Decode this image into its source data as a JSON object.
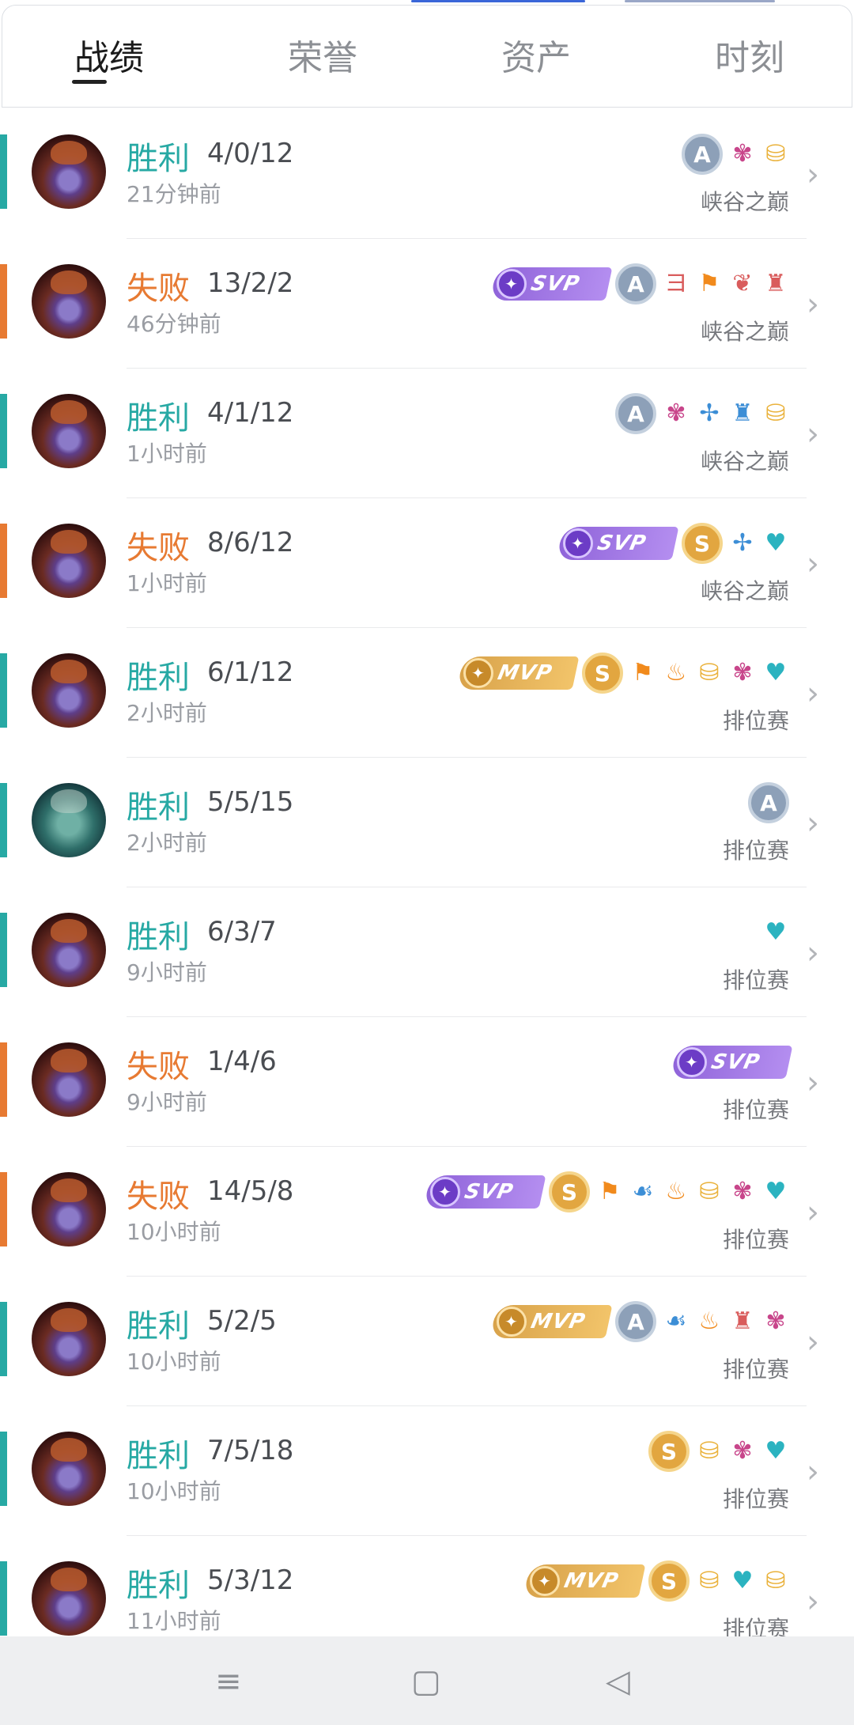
{
  "tabs": [
    {
      "label": "战绩",
      "active": true
    },
    {
      "label": "荣誉",
      "active": false
    },
    {
      "label": "资产",
      "active": false
    },
    {
      "label": "时刻",
      "active": false
    }
  ],
  "colors": {
    "win": "#27a9a4",
    "loss": "#e77a32"
  },
  "matches": [
    {
      "result": "胜利",
      "outcome": "win",
      "kda": "4/0/12",
      "time": "21分钟前",
      "mode": "峡谷之巅",
      "avatar": "hero-portrait",
      "badges": [
        {
          "kind": "grade",
          "value": "A"
        },
        {
          "kind": "icon",
          "name": "demon-mask-icon",
          "glyph": "✾",
          "color": "pink"
        },
        {
          "kind": "icon",
          "name": "gold-coins-up-icon",
          "glyph": "⛁",
          "color": "gold"
        }
      ]
    },
    {
      "result": "失败",
      "outcome": "loss",
      "kda": "13/2/2",
      "time": "46分钟前",
      "mode": "峡谷之巅",
      "avatar": "hero-portrait",
      "badges": [
        {
          "kind": "svp",
          "value": "SVP"
        },
        {
          "kind": "grade",
          "value": "A"
        },
        {
          "kind": "icon",
          "name": "triple-kill-icon",
          "glyph": "ヨ",
          "color": "red"
        },
        {
          "kind": "icon",
          "name": "flag-icon",
          "glyph": "⚑",
          "color": "orange"
        },
        {
          "kind": "icon",
          "name": "lotus-icon",
          "glyph": "❦",
          "color": "red"
        },
        {
          "kind": "icon",
          "name": "tower-icon",
          "glyph": "♜",
          "color": "red"
        }
      ]
    },
    {
      "result": "胜利",
      "outcome": "win",
      "kda": "4/1/12",
      "time": "1小时前",
      "mode": "峡谷之巅",
      "avatar": "hero-portrait",
      "badges": [
        {
          "kind": "grade",
          "value": "A"
        },
        {
          "kind": "icon",
          "name": "demon-mask-icon",
          "glyph": "✾",
          "color": "pink"
        },
        {
          "kind": "icon",
          "name": "wings-icon",
          "glyph": "✢",
          "color": "blue"
        },
        {
          "kind": "icon",
          "name": "chess-tower-icon",
          "glyph": "♜",
          "color": "blue"
        },
        {
          "kind": "icon",
          "name": "gold-coins-up-icon",
          "glyph": "⛁",
          "color": "gold"
        }
      ]
    },
    {
      "result": "失败",
      "outcome": "loss",
      "kda": "8/6/12",
      "time": "1小时前",
      "mode": "峡谷之巅",
      "avatar": "hero-portrait",
      "badges": [
        {
          "kind": "svp",
          "value": "SVP"
        },
        {
          "kind": "grade",
          "value": "S"
        },
        {
          "kind": "icon",
          "name": "wings-icon",
          "glyph": "✢",
          "color": "blue"
        },
        {
          "kind": "icon",
          "name": "heart-plus-icon",
          "glyph": "♥",
          "color": "teal"
        }
      ]
    },
    {
      "result": "胜利",
      "outcome": "win",
      "kda": "6/1/12",
      "time": "2小时前",
      "mode": "排位赛",
      "avatar": "hero-portrait",
      "badges": [
        {
          "kind": "mvp",
          "value": "MVP"
        },
        {
          "kind": "grade",
          "value": "S"
        },
        {
          "kind": "icon",
          "name": "flag-icon",
          "glyph": "⚑",
          "color": "orange"
        },
        {
          "kind": "icon",
          "name": "flame-icon",
          "glyph": "♨",
          "color": "orange"
        },
        {
          "kind": "icon",
          "name": "gold-coins-icon",
          "glyph": "⛁",
          "color": "gold"
        },
        {
          "kind": "icon",
          "name": "demon-mask-icon",
          "glyph": "✾",
          "color": "pink"
        },
        {
          "kind": "icon",
          "name": "heart-plus-icon",
          "glyph": "♥",
          "color": "teal"
        }
      ]
    },
    {
      "result": "胜利",
      "outcome": "win",
      "kda": "5/5/15",
      "time": "2小时前",
      "mode": "排位赛",
      "avatar": "hero-portrait-alt",
      "badges": [
        {
          "kind": "grade",
          "value": "A"
        }
      ]
    },
    {
      "result": "胜利",
      "outcome": "win",
      "kda": "6/3/7",
      "time": "9小时前",
      "mode": "排位赛",
      "avatar": "hero-portrait",
      "badges": [
        {
          "kind": "icon",
          "name": "heart-plus-icon",
          "glyph": "♥",
          "color": "teal"
        }
      ]
    },
    {
      "result": "失败",
      "outcome": "loss",
      "kda": "1/4/6",
      "time": "9小时前",
      "mode": "排位赛",
      "avatar": "hero-portrait",
      "badges": [
        {
          "kind": "svp",
          "value": "SVP"
        }
      ]
    },
    {
      "result": "失败",
      "outcome": "loss",
      "kda": "14/5/8",
      "time": "10小时前",
      "mode": "排位赛",
      "avatar": "hero-portrait",
      "badges": [
        {
          "kind": "svp",
          "value": "SVP"
        },
        {
          "kind": "grade",
          "value": "S"
        },
        {
          "kind": "icon",
          "name": "flag-icon",
          "glyph": "⚑",
          "color": "orange"
        },
        {
          "kind": "icon",
          "name": "water-icon",
          "glyph": "☙",
          "color": "blue"
        },
        {
          "kind": "icon",
          "name": "flame-icon",
          "glyph": "♨",
          "color": "orange"
        },
        {
          "kind": "icon",
          "name": "gold-coins-icon",
          "glyph": "⛁",
          "color": "gold"
        },
        {
          "kind": "icon",
          "name": "demon-mask-icon",
          "glyph": "✾",
          "color": "pink"
        },
        {
          "kind": "icon",
          "name": "heart-plus-icon",
          "glyph": "♥",
          "color": "teal"
        }
      ]
    },
    {
      "result": "胜利",
      "outcome": "win",
      "kda": "5/2/5",
      "time": "10小时前",
      "mode": "排位赛",
      "avatar": "hero-portrait",
      "badges": [
        {
          "kind": "mvp",
          "value": "MVP"
        },
        {
          "kind": "grade",
          "value": "A"
        },
        {
          "kind": "icon",
          "name": "water-icon",
          "glyph": "☙",
          "color": "blue"
        },
        {
          "kind": "icon",
          "name": "flame-icon",
          "glyph": "♨",
          "color": "orange"
        },
        {
          "kind": "icon",
          "name": "tower-icon",
          "glyph": "♜",
          "color": "red"
        },
        {
          "kind": "icon",
          "name": "demon-mask-icon",
          "glyph": "✾",
          "color": "pink"
        }
      ]
    },
    {
      "result": "胜利",
      "outcome": "win",
      "kda": "7/5/18",
      "time": "10小时前",
      "mode": "排位赛",
      "avatar": "hero-portrait",
      "badges": [
        {
          "kind": "grade",
          "value": "S"
        },
        {
          "kind": "icon",
          "name": "gold-coins-icon",
          "glyph": "⛁",
          "color": "gold"
        },
        {
          "kind": "icon",
          "name": "demon-mask-icon",
          "glyph": "✾",
          "color": "pink"
        },
        {
          "kind": "icon",
          "name": "heart-plus-icon",
          "glyph": "♥",
          "color": "teal"
        }
      ]
    },
    {
      "result": "胜利",
      "outcome": "win",
      "kda": "5/3/12",
      "time": "11小时前",
      "mode": "排位赛",
      "avatar": "hero-portrait",
      "badges": [
        {
          "kind": "mvp",
          "value": "MVP"
        },
        {
          "kind": "grade",
          "value": "S"
        },
        {
          "kind": "icon",
          "name": "gold-coins-icon",
          "glyph": "⛁",
          "color": "gold"
        },
        {
          "kind": "icon",
          "name": "heart-plus-icon",
          "glyph": "♥",
          "color": "teal"
        },
        {
          "kind": "icon",
          "name": "gold-coins-up-icon",
          "glyph": "⛁",
          "color": "gold"
        }
      ]
    }
  ],
  "navbar": {
    "menu_glyph": "≡",
    "home_glyph": "▢",
    "back_glyph": "◁"
  }
}
